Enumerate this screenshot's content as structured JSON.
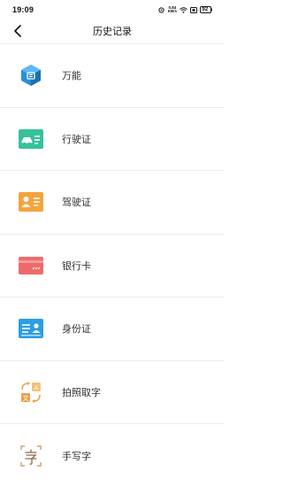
{
  "status_bar": {
    "time": "19:09",
    "speed_top": "0.84",
    "speed_bottom": "KB/s",
    "battery": "92"
  },
  "header": {
    "title": "历史记录",
    "back_icon": "chevron-left-icon"
  },
  "list": {
    "items": [
      {
        "label": "万能",
        "icon": "cube-box-icon",
        "color": "#2a8fd6"
      },
      {
        "label": "行驶证",
        "icon": "car-card-icon",
        "color": "#35c29a"
      },
      {
        "label": "驾驶证",
        "icon": "person-card-icon",
        "color": "#f5a33b"
      },
      {
        "label": "银行卡",
        "icon": "bank-card-icon",
        "color": "#ee6a6a"
      },
      {
        "label": "身份证",
        "icon": "id-card-icon",
        "color": "#2a9ee6"
      },
      {
        "label": "拍照取字",
        "icon": "translate-icon",
        "color": "#e8a24a"
      },
      {
        "label": "手写字",
        "icon": "handwriting-icon",
        "color": "#c9a37a"
      }
    ]
  }
}
